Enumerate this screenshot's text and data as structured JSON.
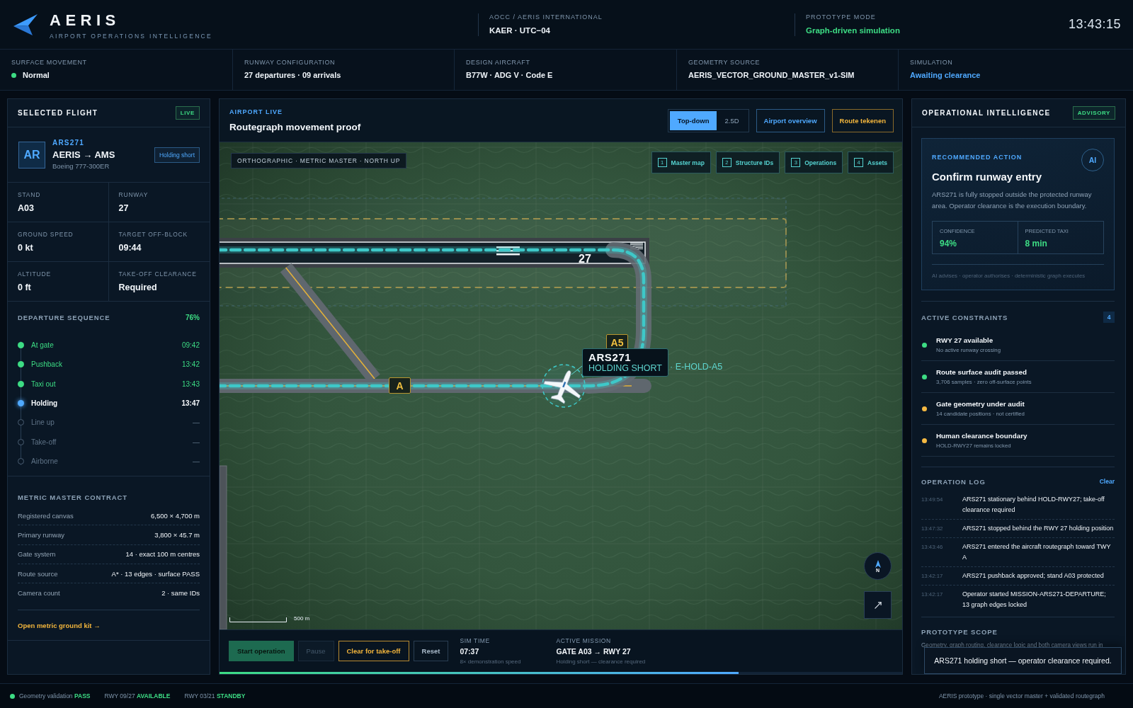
{
  "header": {
    "brand": "AERIS",
    "tagline": "AIRPORT OPERATIONS INTELLIGENCE",
    "meta": [
      {
        "label": "AOCC / AERIS INTERNATIONAL",
        "value": "KAER · UTC−04",
        "color": "#eef3f8"
      },
      {
        "label": "PROTOTYPE MODE",
        "value": "Graph-driven simulation",
        "color": "#3ddc84"
      }
    ],
    "clock": "13:43:15"
  },
  "status_strip": [
    {
      "label": "SURFACE MOVEMENT",
      "value": "Normal",
      "kind": "dot",
      "color": "#eef3f8"
    },
    {
      "label": "RUNWAY CONFIGURATION",
      "value": "27 departures · 09 arrivals",
      "kind": "plain",
      "color": "#eef3f8"
    },
    {
      "label": "DESIGN AIRCRAFT",
      "value": "B77W · ADG V · Code E",
      "kind": "plain",
      "color": "#eef3f8"
    },
    {
      "label": "GEOMETRY SOURCE",
      "value": "AERIS_VECTOR_GROUND_MASTER_v1-SIM",
      "kind": "plain",
      "color": "#eef3f8"
    },
    {
      "label": "SIMULATION",
      "value": "Awaiting clearance",
      "kind": "plain",
      "color": "#4fa9ff"
    }
  ],
  "selected_flight": {
    "title": "SELECTED FLIGHT",
    "badge": "LIVE",
    "avatar": "AR",
    "callsign": "ARS271",
    "route": "AERIS → AMS",
    "aircraft": "Boeing 777-300ER",
    "status": "Holding short",
    "stats": [
      {
        "label": "STAND",
        "value": "A03"
      },
      {
        "label": "RUNWAY",
        "value": "27"
      },
      {
        "label": "GROUND SPEED",
        "value": "0 kt"
      },
      {
        "label": "TARGET OFF-BLOCK",
        "value": "09:44"
      },
      {
        "label": "ALTITUDE",
        "value": "0 ft"
      },
      {
        "label": "TAKE-OFF CLEARANCE",
        "value": "Required"
      }
    ]
  },
  "departure_sequence": {
    "title": "DEPARTURE SEQUENCE",
    "progress": "76%",
    "steps": [
      {
        "label": "At gate",
        "time": "09:42",
        "completed": true,
        "current": false
      },
      {
        "label": "Pushback",
        "time": "13:42",
        "completed": true,
        "current": false
      },
      {
        "label": "Taxi out",
        "time": "13:43",
        "completed": true,
        "current": false
      },
      {
        "label": "Holding",
        "time": "13:47",
        "completed": false,
        "current": true
      },
      {
        "label": "Line up",
        "time": "—",
        "completed": false,
        "current": false
      },
      {
        "label": "Take-off",
        "time": "—",
        "completed": false,
        "current": false
      },
      {
        "label": "Airborne",
        "time": "—",
        "completed": false,
        "current": false
      }
    ]
  },
  "metric_master_contract": {
    "title": "METRIC MASTER CONTRACT",
    "rows": [
      {
        "label": "Registered canvas",
        "value": "6,500 × 4,700 m"
      },
      {
        "label": "Primary runway",
        "value": "3,800 × 45.7 m"
      },
      {
        "label": "Gate system",
        "value": "14 · exact 100 m centres"
      },
      {
        "label": "Route source",
        "value": "A* · 13 edges · surface PASS"
      },
      {
        "label": "Camera count",
        "value": "2 · same IDs"
      }
    ],
    "link": "Open metric ground kit →"
  },
  "map_panel": {
    "eyebrow": "AIRPORT LIVE",
    "title": "Routegraph movement proof",
    "view_modes": [
      {
        "label": "Top-down",
        "selected": true
      },
      {
        "label": "2.5D",
        "selected": false
      }
    ],
    "actions": [
      {
        "label": "Airport overview",
        "kind": "primary"
      },
      {
        "label": "Route tekenen",
        "kind": "warning"
      }
    ],
    "map": {
      "projection": "ORTHOGRAPHIC · METRIC MASTER · NORTH UP",
      "layers": [
        {
          "key": "1",
          "label": "Master map"
        },
        {
          "key": "2",
          "label": "Structure IDs"
        },
        {
          "key": "3",
          "label": "Operations"
        },
        {
          "key": "4",
          "label": "Assets"
        }
      ],
      "runway_marking": "27",
      "taxiway_labels": [
        "A5",
        "A"
      ],
      "aircraft_callout": {
        "callsign": "ARS271",
        "status": "HOLDING SHORT",
        "hold_point": "· E-HOLD-A5"
      },
      "compass": "N",
      "scale": "500 m"
    },
    "controls": {
      "buttons": [
        {
          "label": "Start operation",
          "kind": "primary",
          "disabled": false
        },
        {
          "label": "Pause",
          "kind": "ghost",
          "disabled": true
        },
        {
          "label": "Clear for take-off",
          "kind": "warning",
          "disabled": false
        },
        {
          "label": "Reset",
          "kind": "ghost",
          "disabled": false
        }
      ],
      "sim_time": {
        "label": "SIM TIME",
        "value": "07:37",
        "note": "8× demonstration speed"
      },
      "mission": {
        "label": "ACTIVE MISSION",
        "value": "GATE A03 → RWY 27",
        "note": "Holding short — clearance required"
      },
      "progress": {
        "level": 0.76
      }
    }
  },
  "operational_intelligence": {
    "title": "OPERATIONAL INTELLIGENCE",
    "badge": "ADVISORY",
    "recommendation": {
      "eyebrow": "RECOMMENDED ACTION",
      "ai_badge": "AI",
      "title": "Confirm runway entry",
      "body": "ARS271 is fully stopped outside the protected runway area. Operator clearance is the execution boundary.",
      "metrics": [
        {
          "label": "CONFIDENCE",
          "value": "94%"
        },
        {
          "label": "PREDICTED TAXI",
          "value": "8 min"
        }
      ],
      "footnote": "AI advises · operator authorises · deterministic graph executes"
    },
    "constraints": {
      "title": "ACTIVE CONSTRAINTS",
      "count": "4",
      "items": [
        {
          "title": "RWY 27 available",
          "detail": "No active runway crossing",
          "color": "#3ddc84"
        },
        {
          "title": "Route surface audit passed",
          "detail": "3,706 samples · zero off-surface points",
          "color": "#3ddc84"
        },
        {
          "title": "Gate geometry under audit",
          "detail": "14 candidate positions · not certified",
          "color": "#f5b942"
        },
        {
          "title": "Human clearance boundary",
          "detail": "HOLD-RWY27 remains locked",
          "color": "#f5b942"
        }
      ]
    },
    "log": {
      "title": "OPERATION LOG",
      "action": "Clear",
      "entries": [
        {
          "time": "13:49:54",
          "message": "ARS271 stationary behind HOLD-RWY27; take-off clearance required"
        },
        {
          "time": "13:47:32",
          "message": "ARS271 stopped behind the RWY 27 holding position"
        },
        {
          "time": "13:43:46",
          "message": "ARS271 entered the aircraft routegraph toward TWY A"
        },
        {
          "time": "13:42:17",
          "message": "ARS271 pushback approved; stand A03 protected"
        },
        {
          "time": "13:42:17",
          "message": "Operator started MISSION-ARS271-DEPARTURE; 13 graph edges locked"
        }
      ]
    },
    "scope": {
      "title": "PROTOTYPE SCOPE",
      "text": "Geometry, graph routing, clearance logic and both camera views run in"
    },
    "toast": "ARS271 holding short — operator clearance required."
  },
  "footer": {
    "items": [
      {
        "kind": "dot",
        "label": "Geometry validation",
        "value": "PASS"
      },
      {
        "kind": "plain",
        "label": "RWY 09/27",
        "value": "AVAILABLE"
      },
      {
        "kind": "plain",
        "label": "RWY 03/21",
        "value": "STANDBY"
      }
    ],
    "note": "AERIS prototype · single vector master + validated routegraph"
  }
}
